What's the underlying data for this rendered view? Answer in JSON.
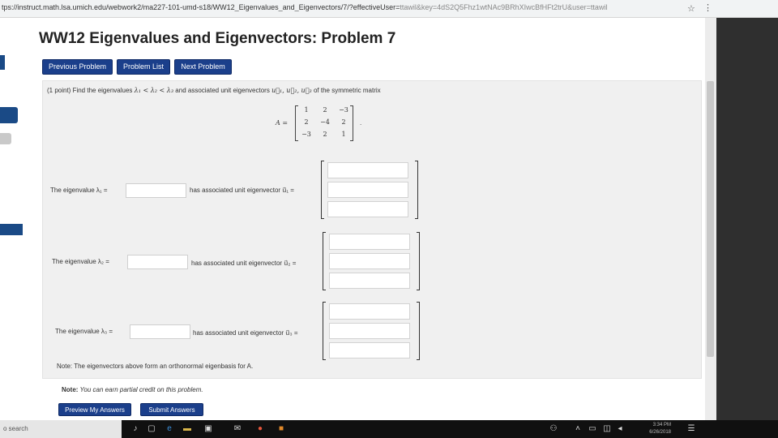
{
  "browser": {
    "url_main": "tps://instruct.math.lsa.umich.edu/webwork2/ma227-101-umd-s18/WW12_Eigenvalues_and_Eigenvectors/7/?effectiveUser=",
    "url_rest": "ttawil&key=4dS2Q5Fhz1wtNAc9BRhXIwcBfHFt2trU&user=ttawil",
    "star_icon": "star-icon",
    "menu_icon": "kebab-menu-icon"
  },
  "page": {
    "title": "WW12 Eigenvalues and Eigenvectors: Problem 7",
    "nav": {
      "previous": "Previous Problem",
      "list": "Problem List",
      "next": "Next Problem"
    }
  },
  "problem": {
    "prompt_prefix": "(1 point) Find the eigenvalues",
    "prompt_lambdas": "λ₁ < λ₂ < λ₃",
    "prompt_mid": "and associated unit eigenvectors",
    "prompt_vectors": "u⃗₁, u⃗₂, u⃗₃",
    "prompt_suffix": "of the symmetric matrix",
    "matrix_label": "A =",
    "matrix_end": ".",
    "matrix": [
      [
        "1",
        "2",
        "−3"
      ],
      [
        "2",
        "−4",
        "2"
      ],
      [
        "−3",
        "2",
        "1"
      ]
    ],
    "rows": [
      {
        "eig_label": "The eigenvalue λ₁ =",
        "vec_label": "has associated unit eigenvector u⃗₁ =",
        "eig_value": "",
        "vec_values": [
          "",
          "",
          ""
        ]
      },
      {
        "eig_label": "The eigenvalue λ₂ =",
        "vec_label": "has associated unit eigenvector u⃗₂ =",
        "eig_value": "",
        "vec_values": [
          "",
          "",
          ""
        ]
      },
      {
        "eig_label": "The eigenvalue λ₃ =",
        "vec_label": "has associated unit eigenvector u⃗₃ =",
        "eig_value": "",
        "vec_values": [
          "",
          "",
          ""
        ]
      }
    ],
    "note": "Note: The eigenvectors above form an orthonormal eigenbasis for A."
  },
  "footer": {
    "note_bold": "Note:",
    "note_text": "You can earn partial credit on this problem.",
    "preview": "Preview My Answers",
    "submit": "Submit Answers"
  },
  "taskbar": {
    "search": "o search",
    "time": "3:34 PM",
    "date": "6/26/2018"
  },
  "colors": {
    "nav_button": "#1b3f8b",
    "problem_bg": "#f0f0f0"
  }
}
